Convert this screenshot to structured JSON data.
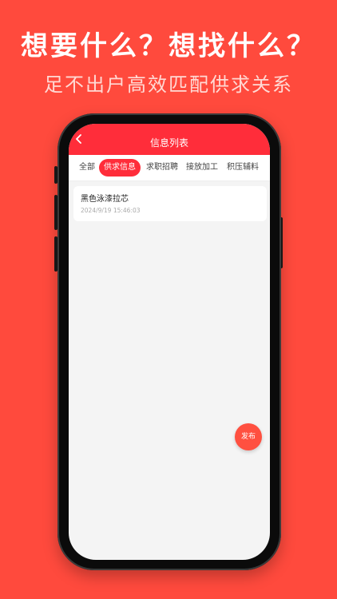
{
  "banner": {
    "headline": "想要什么？想找什么？",
    "subline": "足不出户高效匹配供求关系"
  },
  "app": {
    "title": "信息列表",
    "back_icon": "chevron-left-icon",
    "tabs": [
      {
        "label": "全部",
        "active": false
      },
      {
        "label": "供求信息",
        "active": true
      },
      {
        "label": "求职招聘",
        "active": false
      },
      {
        "label": "接放加工",
        "active": false
      },
      {
        "label": "积压辅料",
        "active": false
      }
    ],
    "items": [
      {
        "title": "黑色泳漆拉芯",
        "time": "2024/9/19 15:46:03"
      }
    ],
    "publish_label": "发布"
  },
  "colors": {
    "background": "#ff4a3d",
    "accent": "#ff2d3a",
    "publish": "#ff5040"
  }
}
